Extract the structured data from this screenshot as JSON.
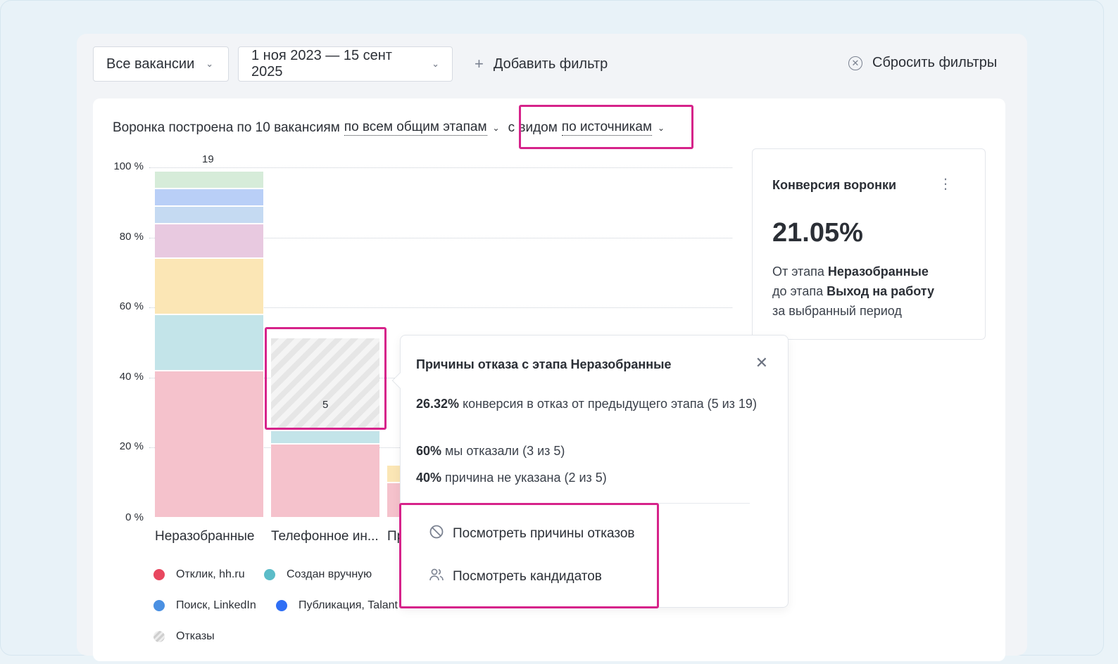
{
  "filters": {
    "vacancies": "Все вакансии",
    "period": "1 ноя 2023 — 15 сент 2025",
    "add_filter": "Добавить фильтр",
    "reset": "Сбросить фильтры"
  },
  "subtitle": {
    "prefix": "Воронка построена по 10 вакансиям",
    "stages_link": "по всем общим этапам",
    "view_prefix": "с видом",
    "view_link": "по источникам"
  },
  "chart_data": {
    "type": "bar",
    "stacked": true,
    "y_ticks": [
      "100 %",
      "80 %",
      "60 %",
      "40 %",
      "20 %",
      "0 %"
    ],
    "ylim": [
      0,
      100
    ],
    "categories": [
      "Неразобранные",
      "Телефонное ин...",
      "Пр"
    ],
    "totals": [
      "19",
      "5",
      ""
    ],
    "series": [
      {
        "name": "Отклик, hh.ru",
        "color": "#f5c2cc",
        "values": [
          42,
          21,
          10
        ]
      },
      {
        "name": "Создан вручную",
        "color": "#c3e4e9",
        "values": [
          16,
          4,
          0
        ]
      },
      {
        "name": "",
        "color": "#fbe6b5",
        "values": [
          16,
          0,
          5
        ]
      },
      {
        "name": "",
        "color": "#e8c9e0",
        "values": [
          10,
          0,
          0
        ]
      },
      {
        "name": "Поиск, LinkedIn",
        "color": "#c5daf2",
        "values": [
          5,
          0,
          0
        ]
      },
      {
        "name": "Публикация, Talant",
        "color": "#b9cff7",
        "values": [
          5,
          0,
          0
        ]
      },
      {
        "name": "",
        "color": "#d6ecd9",
        "values": [
          5,
          0,
          0
        ]
      }
    ],
    "rejections": {
      "name": "Отказы",
      "category": "Телефонное ин...",
      "value_label": "5",
      "values": [
        0,
        27,
        0
      ]
    }
  },
  "legend": [
    {
      "label": "Отклик, hh.ru",
      "color": "#e8475f"
    },
    {
      "label": "Создан вручную",
      "color": "#5bbcc8"
    },
    {
      "label": "Поиск, LinkedIn",
      "color": "#4a90e2"
    },
    {
      "label": "Публикация, Talant",
      "color": "#2f6ff5"
    },
    {
      "label": "Отказы",
      "color": "#d9d9d9"
    }
  ],
  "conversion": {
    "title": "Конверсия воронки",
    "value": "21.05%",
    "line1_prefix": "От этапа ",
    "line1_bold": "Неразобранные",
    "line2_prefix": "до этапа ",
    "line2_bold": "Выход на работу",
    "line3": "за выбранный период"
  },
  "tooltip": {
    "title": "Причины отказа с этапа Неразобранные",
    "stat1_bold": "26.32%",
    "stat1_text": " конверсия в отказ от предыдущего этапа (5 из 19)",
    "stat2_bold": "60%",
    "stat2_text": " мы отказали (3 из 5)",
    "stat3_bold": "40%",
    "stat3_text": " причина не указана (2 из 5)",
    "action1": "Посмотреть причины отказов",
    "action2": "Посмотреть кандидатов"
  }
}
